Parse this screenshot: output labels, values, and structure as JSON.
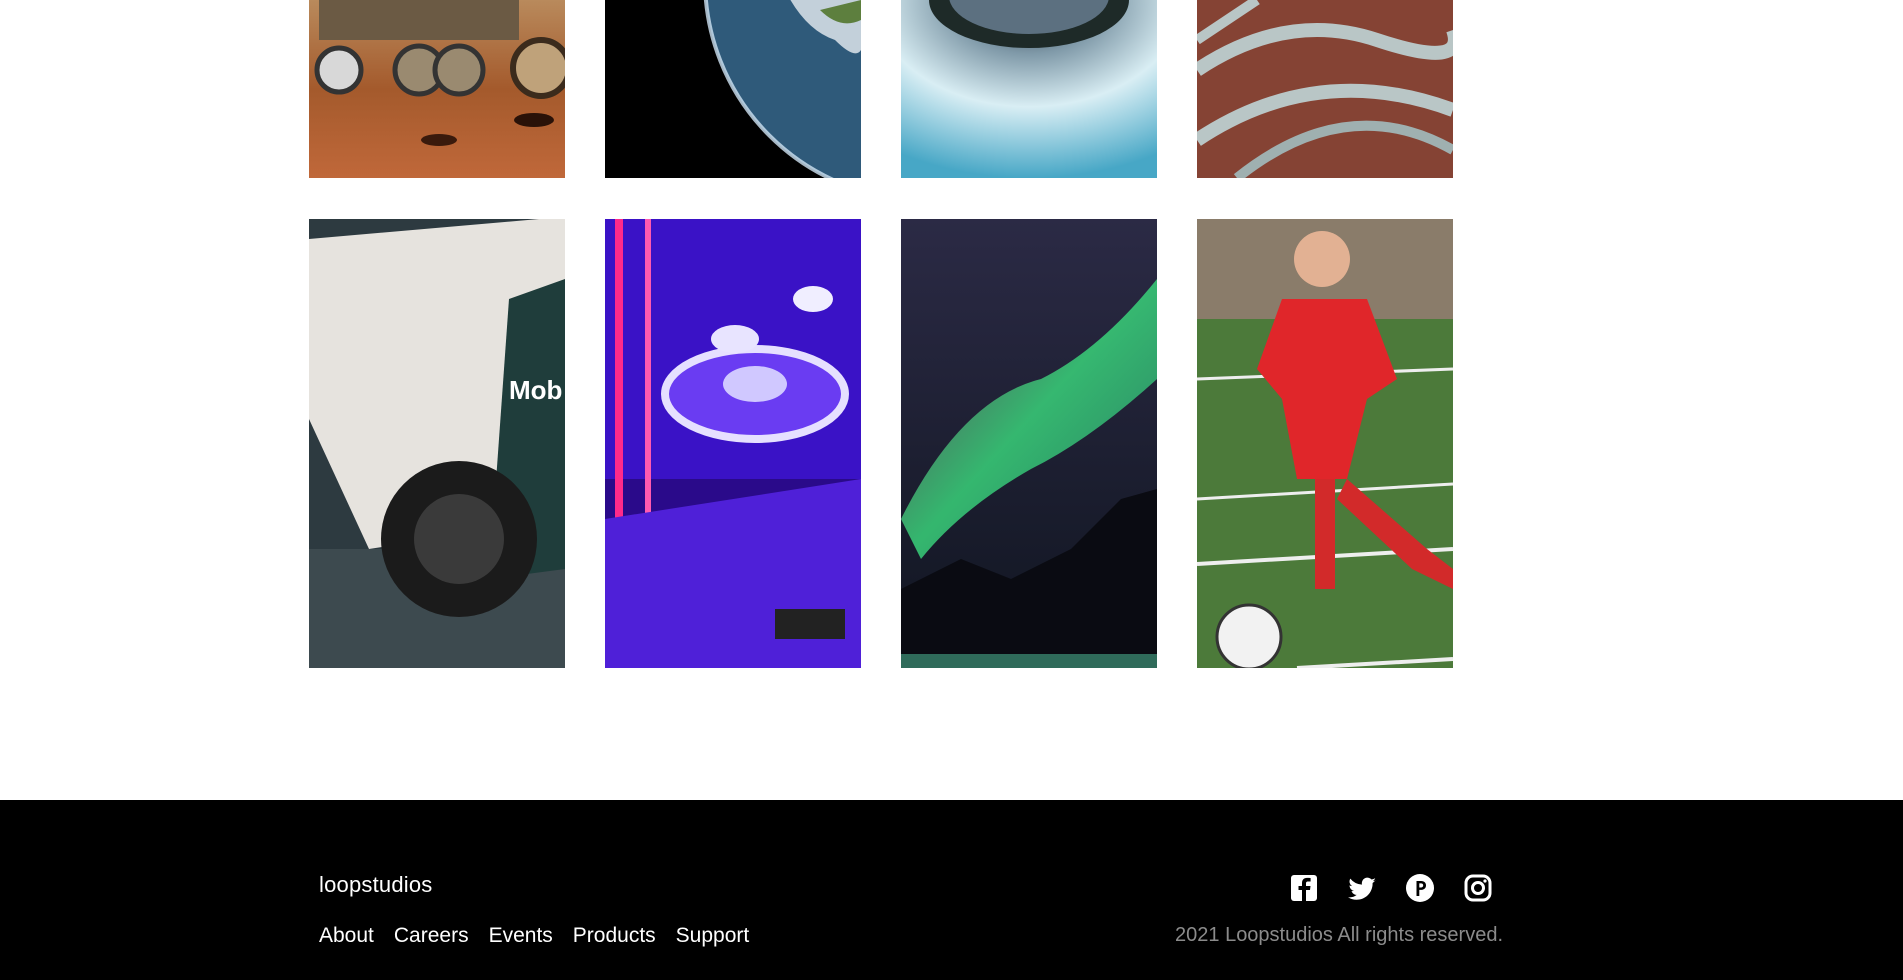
{
  "gallery": {
    "items": [
      {
        "name": "mars-rover",
        "row": 1,
        "col": 1
      },
      {
        "name": "earth-space",
        "row": 1,
        "col": 2
      },
      {
        "name": "fisheye-sky",
        "row": 1,
        "col": 3
      },
      {
        "name": "aerial-roads",
        "row": 1,
        "col": 4
      },
      {
        "name": "race-car",
        "row": 2,
        "col": 1
      },
      {
        "name": "arcade-skeeball",
        "row": 2,
        "col": 2
      },
      {
        "name": "northern-lights",
        "row": 2,
        "col": 3
      },
      {
        "name": "soccer-player",
        "row": 2,
        "col": 4
      }
    ]
  },
  "footer": {
    "brand": "loopstudios",
    "nav": [
      "About",
      "Careers",
      "Events",
      "Products",
      "Support"
    ],
    "social_icons": [
      "facebook-icon",
      "twitter-icon",
      "pinterest-icon",
      "instagram-icon"
    ],
    "copyright": "2021 Loopstudios All rights reserved.",
    "colors": {
      "background": "#000000",
      "text": "#ffffff",
      "muted": "#8b8b8b"
    }
  }
}
